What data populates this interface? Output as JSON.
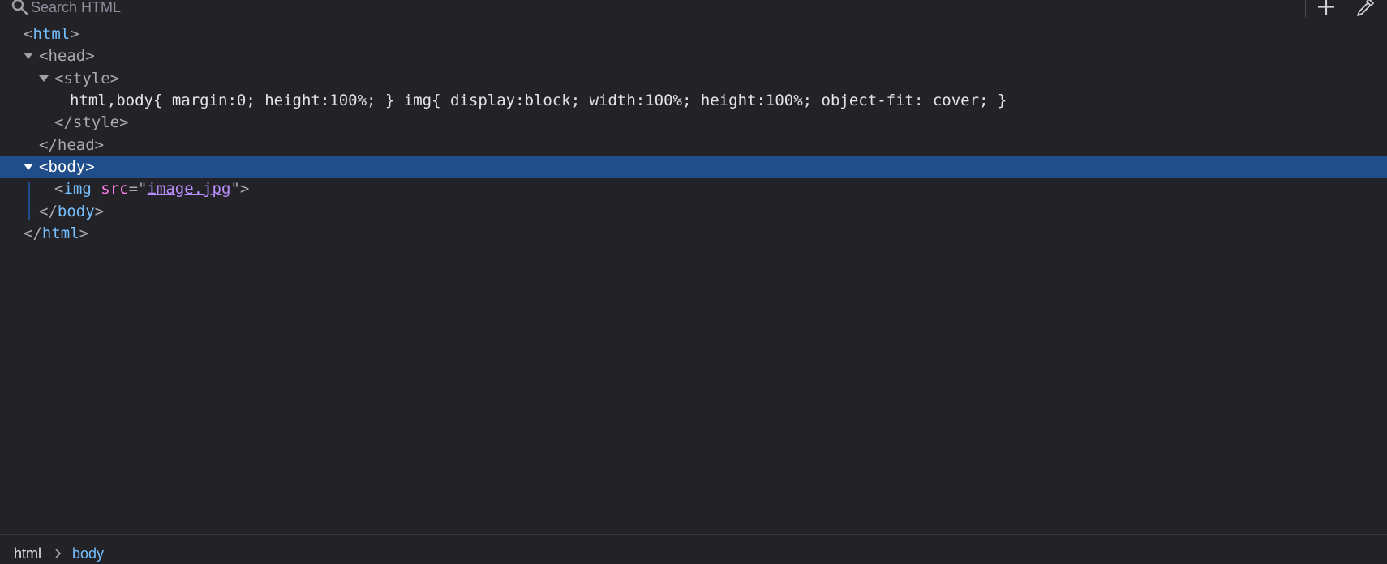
{
  "toolbar": {
    "search_placeholder": "Search HTML",
    "icons": [
      "search-icon",
      "add-icon",
      "eyedropper-icon"
    ]
  },
  "tree": {
    "html_open": {
      "tag": "html"
    },
    "head_open": {
      "tag": "head"
    },
    "style_open": {
      "tag": "style"
    },
    "style_text": "html,body{ margin:0; height:100%; } img{ display:block; width:100%; height:100%; object-fit: cover; }",
    "style_close": {
      "tag": "style"
    },
    "head_close": {
      "tag": "head"
    },
    "body_open": {
      "tag": "body"
    },
    "img": {
      "tag": "img",
      "attr": "src",
      "value": "image.jpg"
    },
    "body_close": {
      "tag": "body"
    },
    "html_close": {
      "tag": "html"
    }
  },
  "breadcrumb": {
    "items": [
      "html",
      "body"
    ]
  },
  "colors": {
    "background": "#232327",
    "selection": "#204e8a",
    "tag": "#75bfff",
    "attribute": "#ff7de9",
    "value": "#b98eff"
  }
}
